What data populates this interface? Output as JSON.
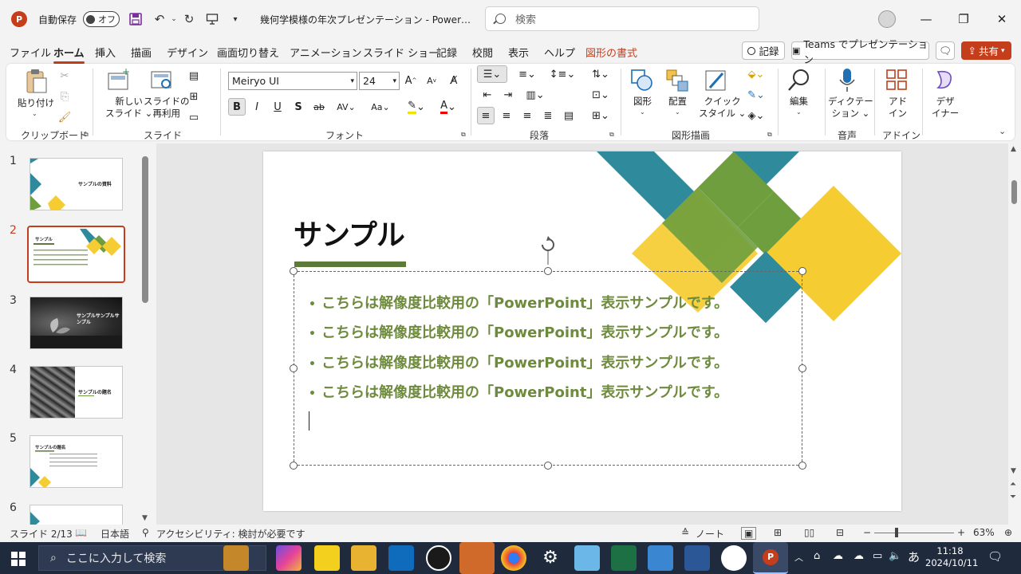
{
  "titlebar": {
    "autosave_label": "自動保存",
    "autosave_state": "オフ",
    "document_title": "幾何学模様の年次プレゼンテーション  -  Power…",
    "search_placeholder": "検索"
  },
  "menu": {
    "tabs": [
      "ファイル",
      "ホーム",
      "挿入",
      "描画",
      "デザイン",
      "画面切り替え",
      "アニメーション",
      "スライド ショー",
      "記録",
      "校閲",
      "表示",
      "ヘルプ",
      "図形の書式"
    ],
    "active_tab": "ホーム",
    "record_button": "記録",
    "teams_button": "Teams でプレゼンテーション",
    "share_button": "共有"
  },
  "ribbon": {
    "clipboard": {
      "paste": "貼り付け",
      "group": "クリップボード"
    },
    "slides": {
      "new_slide": [
        "新しい",
        "スライド"
      ],
      "reuse": [
        "スライドの",
        "再利用"
      ],
      "group": "スライド"
    },
    "font": {
      "font_name": "Meiryo UI",
      "font_size": "24",
      "group": "フォント"
    },
    "paragraph": {
      "group": "段落"
    },
    "drawing": {
      "shapes": "図形",
      "arrange": "配置",
      "quick_styles": [
        "クイック",
        "スタイル"
      ],
      "group": "図形描画"
    },
    "editing": {
      "edit": "編集"
    },
    "voice": {
      "dictate": [
        "ディクテー",
        "ション"
      ],
      "group": "音声"
    },
    "addins": {
      "addins": [
        "アド",
        "イン"
      ],
      "group": "アドイン"
    },
    "designer": {
      "designer": [
        "デザ",
        "イナー"
      ]
    }
  },
  "thumbnails": [
    {
      "number": "1",
      "title": "サンプルの資料"
    },
    {
      "number": "2",
      "title": "サンプル"
    },
    {
      "number": "3",
      "title": "サンプルサンプルサンプル"
    },
    {
      "number": "4",
      "title": "サンプルの題名"
    },
    {
      "number": "5",
      "title": "サンプルの題名"
    },
    {
      "number": "6",
      "title": ""
    }
  ],
  "slide": {
    "title": "サンプル",
    "bullets": [
      "こちらは解像度比較用の「PowerPoint」表示サンプルです。",
      "こちらは解像度比較用の「PowerPoint」表示サンプルです。",
      "こちらは解像度比較用の「PowerPoint」表示サンプルです。",
      "こちらは解像度比較用の「PowerPoint」表示サンプルです。"
    ],
    "colors": {
      "teal": "#2f8b9c",
      "green": "#6e9e3e",
      "yellow": "#f5cc31",
      "text_green": "#6e8b3d",
      "accent": "#c43e1c"
    }
  },
  "statusbar": {
    "slide_position": "スライド 2/13",
    "language": "日本語",
    "accessibility": "アクセシビリティ: 検討が必要です",
    "notes": "ノート",
    "zoom": "63%"
  },
  "taskbar": {
    "search_placeholder": "ここに入力して検索",
    "time": "11:18",
    "date": "2024/10/11",
    "ime": "あ"
  }
}
